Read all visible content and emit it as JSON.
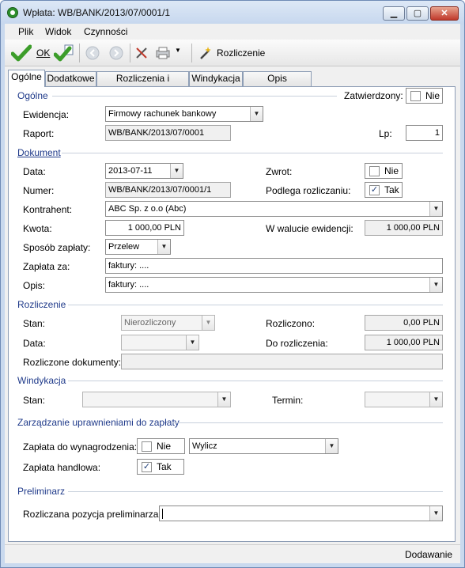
{
  "window": {
    "title": "Wpłata: WB/BANK/2013/07/0001/1"
  },
  "menu": {
    "items": [
      "Plik",
      "Widok",
      "Czynności"
    ]
  },
  "toolbar": {
    "ok_label": "OK",
    "rozliczenie_label": "Rozliczenie"
  },
  "tabs": [
    "Ogólne",
    "Dodatkowe",
    "Rozliczenia i Przelewy",
    "Windykacja",
    "Opis analityczny"
  ],
  "ogolne": {
    "section": "Ogólne",
    "zatwierdzony_label": "Zatwierdzony:",
    "zatwierdzony_value": "Nie",
    "ewidencja_label": "Ewidencja:",
    "ewidencja_value": "Firmowy rachunek bankowy",
    "raport_label": "Raport:",
    "raport_value": "WB/BANK/2013/07/0001",
    "lp_label": "Lp:",
    "lp_value": "1"
  },
  "dokument": {
    "section": "Dokument",
    "data_label": "Data:",
    "data_value": "2013-07-11",
    "zwrot_label": "Zwrot:",
    "zwrot_value": "Nie",
    "numer_label": "Numer:",
    "numer_value": "WB/BANK/2013/07/0001/1",
    "podlega_label": "Podlega rozliczaniu:",
    "podlega_value": "Tak",
    "kontrahent_label": "Kontrahent:",
    "kontrahent_value": "ABC Sp. z o.o (Abc)",
    "kwota_label": "Kwota:",
    "kwota_value": "1 000,00 PLN",
    "walucie_label": "W walucie ewidencji:",
    "walucie_value": "1 000,00 PLN",
    "sposob_label": "Sposób zapłaty:",
    "sposob_value": "Przelew",
    "zaplata_label": "Zapłata za:",
    "zaplata_value": "faktury: ....",
    "opis_label": "Opis:",
    "opis_value": "faktury: ...."
  },
  "rozliczenie": {
    "section": "Rozliczenie",
    "stan_label": "Stan:",
    "stan_value": "Nierozliczony",
    "rozliczono_label": "Rozliczono:",
    "rozliczono_value": "0,00 PLN",
    "data_label": "Data:",
    "do_rozliczenia_label": "Do rozliczenia:",
    "do_rozliczenia_value": "1 000,00 PLN",
    "dokumenty_label": "Rozliczone dokumenty:"
  },
  "windykacja": {
    "section": "Windykacja",
    "stan_label": "Stan:",
    "termin_label": "Termin:"
  },
  "uprawnienia": {
    "section": "Zarządzanie uprawnieniami do zapłaty",
    "wynagrodzenia_label": "Zapłata do wynagrodzenia:",
    "wynagrodzenia_value": "Nie",
    "wylicz_value": "Wylicz",
    "handlowa_label": "Zapłata handlowa:",
    "handlowa_value": "Tak"
  },
  "preliminarz": {
    "section": "Preliminarz",
    "pozycja_label": "Rozliczana pozycja preliminarza:",
    "pozycja_value": ""
  },
  "status": {
    "mode": "Dodawanie"
  },
  "colors": {
    "section_text": "#1f3a8a",
    "check": "#21407a",
    "window_frame": "#c9d9ee"
  }
}
